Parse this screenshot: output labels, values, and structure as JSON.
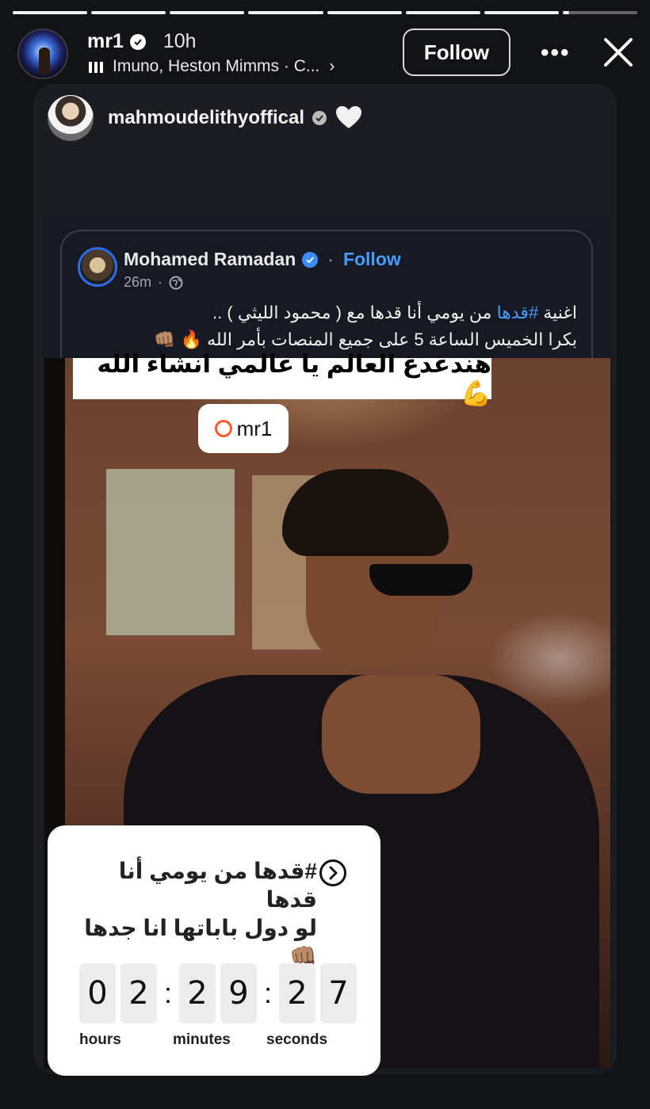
{
  "story": {
    "username": "mr1",
    "time": "10h",
    "music": "Imuno, Heston Mimms · C...",
    "follow_label": "Follow",
    "more_icon": "more-icon",
    "close_icon": "close-icon",
    "progress_segments": 8
  },
  "repost": {
    "username": "mahmoudelithyoffical"
  },
  "threads_post": {
    "author": "Mohamed Ramadan",
    "follow_label": "Follow",
    "time": "26m",
    "line1_prefix": "اغنية ",
    "hashtag": "#قدها",
    "line1_suffix": " من يومي أنا قدها مع ( محمود الليثي ) ..",
    "line2": "بكرا الخميس الساعة 5 على جميع المنصات بأمر الله 🔥 👊🏽"
  },
  "photo_overlay": {
    "caption": "هندغدغ العالم يا عالمي انشاء الله 💪",
    "mention": "mr1"
  },
  "countdown": {
    "title_line1": "#قدها من يومي أنا قدها",
    "title_line2": "لو دول باباتها انا جدها",
    "title_line3": "👊🏽",
    "hours": [
      "0",
      "2"
    ],
    "minutes": [
      "2",
      "9"
    ],
    "seconds": [
      "2",
      "7"
    ],
    "hours_label": "hours",
    "minutes_label": "minutes",
    "seconds_label": "seconds"
  }
}
